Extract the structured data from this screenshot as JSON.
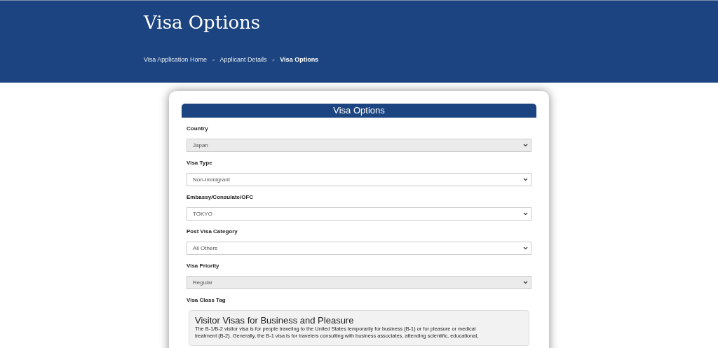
{
  "page_title": "Visa Options",
  "breadcrumb": [
    {
      "label": "Visa Application Home",
      "current": false
    },
    {
      "label": "Applicant Details",
      "current": false
    },
    {
      "label": "Visa Options",
      "current": true
    }
  ],
  "breadcrumb_separator": ">",
  "card": {
    "title": "Visa Options",
    "fields": [
      {
        "label": "Country",
        "value": "Japan",
        "disabled": true
      },
      {
        "label": "Visa Type",
        "value": "Non-Immigrant",
        "disabled": false
      },
      {
        "label": "Embassy/Consulate/OFC",
        "value": "TOKYO",
        "disabled": false
      },
      {
        "label": "Post Visa Category",
        "value": "All Others",
        "disabled": false
      },
      {
        "label": "Visa Priority",
        "value": "Regular",
        "disabled": true
      }
    ],
    "class_tag": {
      "label": "Visa Class Tag",
      "heading": "Visitor Visas for Business and Pleasure",
      "lines": [
        "The B-1/B-2 visitor visa is for people traveling to the United States temporarily for business (B-1) or for pleasure or medical",
        "treatment (B-2). Generally, the B-1 visa is for travelers consulting with business associates, attending scientific, educational,"
      ]
    }
  }
}
